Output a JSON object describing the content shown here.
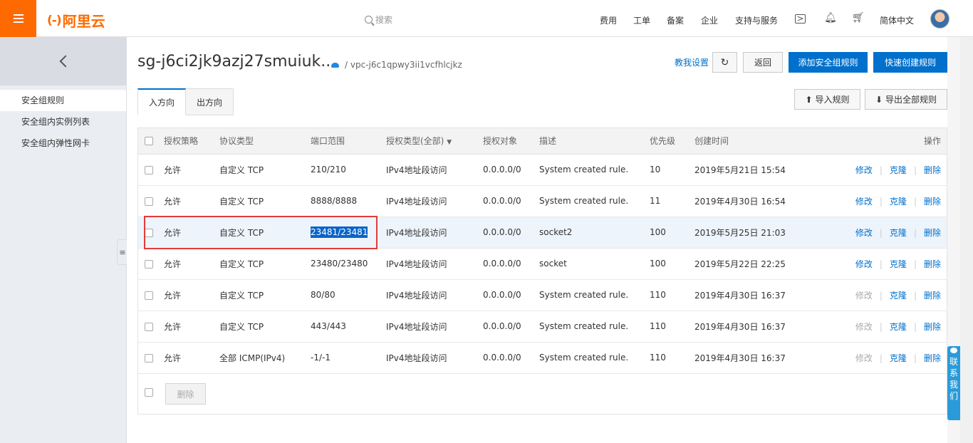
{
  "topbar": {
    "logo_mark": "(-)",
    "logo_text": "阿里云",
    "search_placeholder": "搜索",
    "nav": [
      "费用",
      "工单",
      "备案",
      "企业",
      "支持与服务"
    ],
    "lang": "简体中文",
    "icons": [
      "terminal-icon",
      "bell-icon",
      "cart-icon"
    ]
  },
  "sidebar": {
    "items": [
      "安全组规则",
      "安全组内实例列表",
      "安全组内弹性网卡"
    ]
  },
  "header": {
    "title": "sg-j6ci2jk9azj27smuiuk...",
    "vpc": "/ vpc-j6c1qpwy3ii1vcfhlcjkz",
    "teach_link": "教我设置",
    "back_label": "返回",
    "add_rule_label": "添加安全组规则",
    "quick_rule_label": "快速创建规则",
    "import_label": "导入规则",
    "export_label": "导出全部规则"
  },
  "tabs": [
    "入方向",
    "出方向"
  ],
  "table": {
    "columns": [
      "授权策略",
      "协议类型",
      "端口范围",
      "授权类型(全部)",
      "授权对象",
      "描述",
      "优先级",
      "创建时间",
      "操作"
    ],
    "ops": [
      "修改",
      "克隆",
      "删除"
    ],
    "rows": [
      {
        "policy": "允许",
        "protocol": "自定义 TCP",
        "port": "210/210",
        "auth_type": "IPv4地址段访问",
        "object": "0.0.0.0/0",
        "desc": "System created rule.",
        "priority": "10",
        "time": "2019年5月21日 15:54",
        "edit_disabled": false
      },
      {
        "policy": "允许",
        "protocol": "自定义 TCP",
        "port": "8888/8888",
        "auth_type": "IPv4地址段访问",
        "object": "0.0.0.0/0",
        "desc": "System created rule.",
        "priority": "11",
        "time": "2019年4月30日 16:54",
        "edit_disabled": false
      },
      {
        "policy": "允许",
        "protocol": "自定义 TCP",
        "port": "23481/23481",
        "auth_type": "IPv4地址段访问",
        "object": "0.0.0.0/0",
        "desc": "socket2",
        "priority": "100",
        "time": "2019年5月25日 21:03",
        "edit_disabled": false
      },
      {
        "policy": "允许",
        "protocol": "自定义 TCP",
        "port": "23480/23480",
        "auth_type": "IPv4地址段访问",
        "object": "0.0.0.0/0",
        "desc": "socket",
        "priority": "100",
        "time": "2019年5月22日 22:25",
        "edit_disabled": false
      },
      {
        "policy": "允许",
        "protocol": "自定义 TCP",
        "port": "80/80",
        "auth_type": "IPv4地址段访问",
        "object": "0.0.0.0/0",
        "desc": "System created rule.",
        "priority": "110",
        "time": "2019年4月30日 16:37",
        "edit_disabled": true
      },
      {
        "policy": "允许",
        "protocol": "自定义 TCP",
        "port": "443/443",
        "auth_type": "IPv4地址段访问",
        "object": "0.0.0.0/0",
        "desc": "System created rule.",
        "priority": "110",
        "time": "2019年4月30日 16:37",
        "edit_disabled": true
      },
      {
        "policy": "允许",
        "protocol": "全部 ICMP(IPv4)",
        "port": "-1/-1",
        "auth_type": "IPv4地址段访问",
        "object": "0.0.0.0/0",
        "desc": "System created rule.",
        "priority": "110",
        "time": "2019年4月30日 16:37",
        "edit_disabled": true
      }
    ],
    "batch_delete_label": "删除"
  },
  "contact": "联系我们",
  "colors": {
    "accent": "#ff6a00",
    "primary": "#0070cc",
    "highlight": "#e33b3b"
  }
}
